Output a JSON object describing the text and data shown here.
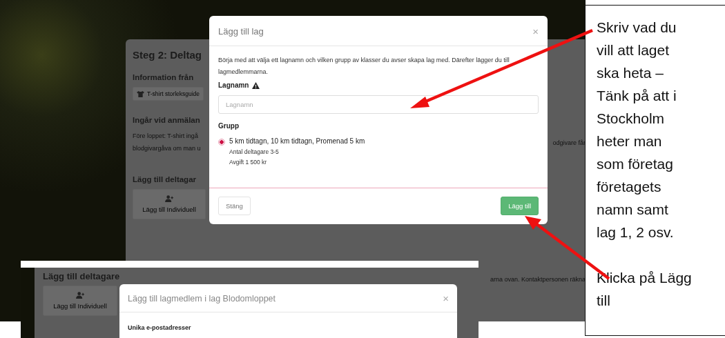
{
  "background_page": {
    "heading": "Steg 2: Deltag",
    "info_heading": "Information från",
    "size_guide_button": "T-shirt storleksguide",
    "included_heading": "Ingår vid anmälan",
    "included_text": [
      "Före loppet: T-shirt ingå",
      "blodgivargåva om man u"
    ],
    "included_text_right": "odgivare får",
    "add_heading": "Lägg till deltagar",
    "add_buttons": [
      "Lägg till Individuell"
    ],
    "lower_right_text": "arna ovan. Kontaktpersonen räkna"
  },
  "modal": {
    "title": "Lägg till lag",
    "close": "×",
    "intro": "Börja med att välja ett lagnamn och vilken grupp av klasser du avser skapa lag med. Därefter lägger du till lagmedlemmarna.",
    "name_label": "Lagnamn",
    "name_field": {
      "placeholder": "Lagnamn"
    },
    "group_label": "Grupp",
    "groups": [
      {
        "label": "5 km tidtagn, 10 km tidtagn, Promenad 5 km",
        "details": [
          "Antal deltagare 3-5",
          "Avgift 1 500 kr"
        ],
        "selected": true
      }
    ],
    "buttons": [
      {
        "label": "Stäng",
        "kind": "secondary"
      },
      {
        "label": "Lägg till",
        "kind": "primary"
      }
    ]
  },
  "second_screenshot": {
    "add_heading": "Lägg till deltagare",
    "add_button": "Lägg till Individuell",
    "modal": {
      "title": "Lägg till lagmedlem i lag Blodomloppet",
      "close": "×",
      "section_label": "Unika e-postadresser"
    }
  },
  "callout": {
    "paragraphs": [
      {
        "lines": [
          "Skriv vad du",
          "vill att laget",
          "ska heta –",
          "Tänk på att i",
          "Stockholm",
          "heter man",
          "som företag",
          "företagets",
          "namn samt",
          "lag 1, 2 osv."
        ]
      },
      {
        "lines": [
          "Klicka på Lägg",
          "till"
        ]
      }
    ]
  }
}
